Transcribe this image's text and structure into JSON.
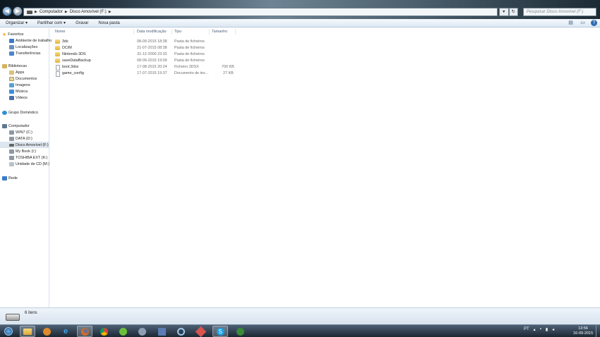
{
  "address_bar": {
    "crumbs": [
      "Computador",
      "Disco Amovível (F:)"
    ],
    "search_placeholder": "Pesquisar Disco Amovível (F:)"
  },
  "toolbar": {
    "organize": "Organizar ▾",
    "share": "Partilhar com ▾",
    "burn": "Gravar",
    "new_folder": "Nova pasta"
  },
  "nav": {
    "favorites": "Favoritos",
    "fav_items": [
      "Ambiente de trabalho",
      "Localizações",
      "Transferências"
    ],
    "libraries": "Bibliotecas",
    "lib_items": [
      "Apps",
      "Documentos",
      "Imagens",
      "Música",
      "Vídeos"
    ],
    "homegroup": "Grupo Doméstico",
    "computer": "Computador",
    "drives": [
      "WIN7 (C:)",
      "DATA (D:)",
      "Disco Amovível (F:)",
      "My Book (I:)",
      "TOSHIBA EXT (K:)",
      "Unidade de CD (M:)"
    ],
    "network": "Rede"
  },
  "columns": {
    "name": "Nome",
    "date": "Data modificação",
    "type": "Tipo",
    "size": "Tamanho"
  },
  "files": [
    {
      "name": "3ds",
      "date": "08-09-2015 18:38",
      "type": "Pasta de ficheiros",
      "size": ""
    },
    {
      "name": "DCIM",
      "date": "21-07-2015 08:38",
      "type": "Pasta de ficheiros",
      "size": ""
    },
    {
      "name": "Nintendo 3DS",
      "date": "31-12-2000 23:32",
      "type": "Pasta de ficheiros",
      "size": ""
    },
    {
      "name": "saveDataBackup",
      "date": "08-09-2015 19:09",
      "type": "Pasta de ficheiros",
      "size": ""
    },
    {
      "name": "boot.3dsx",
      "date": "17-08-2015 20:24",
      "type": "Ficheiro 3DSX",
      "size": "700 KB"
    },
    {
      "name": "game_config",
      "date": "17-07-2015 19:37",
      "type": "Documento de tex...",
      "size": "27 KB"
    }
  ],
  "status": {
    "count": "6 itens"
  },
  "taskbar": {
    "lang": "PT",
    "time": "13:56",
    "date": "16-09-2015"
  }
}
